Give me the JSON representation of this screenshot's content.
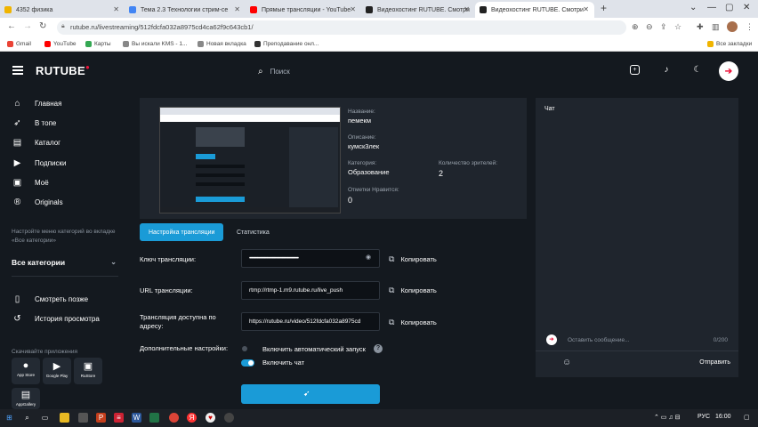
{
  "browser": {
    "tabs": [
      {
        "label": "4352 физика",
        "color": "#f0b400"
      },
      {
        "label": "Тема 2.3 Технологии стрим-се",
        "color": "#4285f4"
      },
      {
        "label": "Прямые трансляции - YouTube",
        "color": "#ff0000"
      },
      {
        "label": "Видеохостинг RUTUBE. Смотри",
        "color": "#222222"
      },
      {
        "label": "Видеохостинг RUTUBE. Смотри",
        "color": "#222222",
        "active": true
      }
    ],
    "new_tab": "+",
    "url": "rutube.ru/livestreaming/512fdcfa032a8975cd4ca62f9c643cb1/",
    "bookmarks": [
      {
        "label": "Gmail",
        "color": "#ea4335"
      },
      {
        "label": "YouTube",
        "color": "#ff0000"
      },
      {
        "label": "Карты",
        "color": "#34a853"
      },
      {
        "label": "Вы искали KMS - 1...",
        "color": "#888888"
      },
      {
        "label": "Новая вкладка",
        "color": "#888888"
      },
      {
        "label": "Преподавание онл...",
        "color": "#333333"
      }
    ],
    "all_bookmarks": "Все закладки"
  },
  "header": {
    "logo": "RUTUBE",
    "search_placeholder": "Поиск"
  },
  "sidebar": {
    "items": [
      {
        "label": "Главная",
        "icon": "home-icon",
        "glyph": "⌂"
      },
      {
        "label": "В топе",
        "icon": "rocket-icon",
        "glyph": "➶"
      },
      {
        "label": "Каталог",
        "icon": "catalog-icon",
        "glyph": "▤"
      },
      {
        "label": "Подписки",
        "icon": "subscriptions-icon",
        "glyph": "▶"
      },
      {
        "label": "Моё",
        "icon": "folder-icon",
        "glyph": "▣"
      },
      {
        "label": "Originals",
        "icon": "originals-icon",
        "glyph": "®"
      }
    ],
    "hint": "Настройте меню категорий во вкладке «Все категории»",
    "all_categories": "Все категории",
    "bottom_items": [
      {
        "label": "Смотреть позже",
        "icon": "bookmark-icon",
        "glyph": "▯"
      },
      {
        "label": "История просмотра",
        "icon": "history-icon",
        "glyph": "↺"
      }
    ],
    "apps_title": "Скачивайте приложения",
    "stores": [
      "App Store",
      "Google Play",
      "RuStore",
      "AppGallery"
    ]
  },
  "stream_info": {
    "name_label": "Название:",
    "name_value": "пемекм",
    "desc_label": "Описание:",
    "desc_value": "кумск3лек",
    "category_label": "Категория:",
    "category_value": "Образование",
    "viewers_label": "Количество зрителей:",
    "viewers_value": "2",
    "likes_label": "Отметки Нравится:",
    "likes_value": "0"
  },
  "tabs": {
    "settings": "Настройка трансляции",
    "stats": "Статистика"
  },
  "settings": {
    "key_label": "Ключ трансляции:",
    "key_value": "••••••••••••••••••••••••••••••••••••••••••••••••••",
    "url_label": "URL трансляции:",
    "url_value": "rtmp://rtmp-1.m9.rutube.ru/live_push",
    "access_label": "Трансляция доступна по адресу:",
    "access_value": "https://rutube.ru/video/512fdcfa032a8975cd",
    "copy_label": "Копировать",
    "extra_label": "Дополнительные настройки:",
    "autostart_label": "Включить автоматический запуск",
    "chat_toggle_label": "Включить чат",
    "autostart_on": false,
    "chat_on": true
  },
  "chat": {
    "title": "Чат",
    "placeholder": "Оставить сообщение...",
    "counter": "0/200",
    "send": "Отправить"
  },
  "taskbar": {
    "lang": "РУС",
    "time": "16:00"
  }
}
